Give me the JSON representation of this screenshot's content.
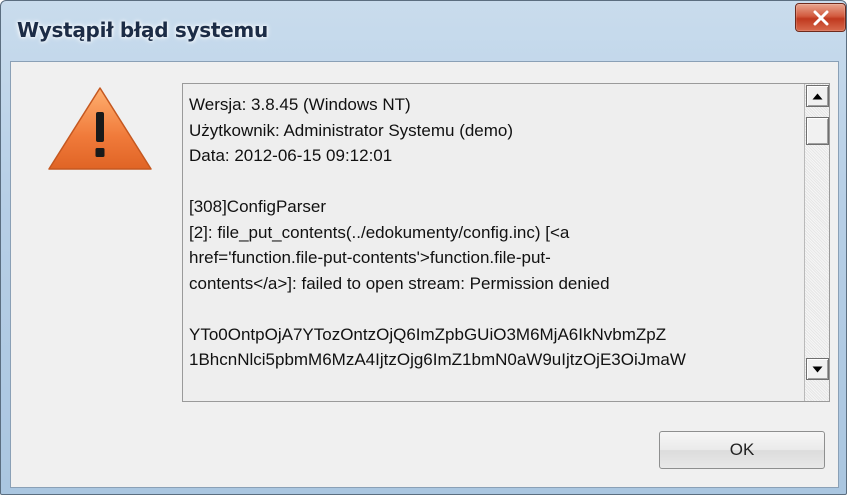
{
  "window": {
    "title": "Wystąpił błąd systemu",
    "close_glyph": "✕"
  },
  "icon": "warning-icon",
  "message": {
    "lines": [
      "Wersja: 3.8.45 (Windows NT)",
      "Użytkownik: Administrator Systemu (demo)",
      "Data: 2012-06-15 09:12:01",
      "",
      "[308]ConfigParser",
      "[2]: file_put_contents(../edokumenty/config.inc) [<a",
      "href='function.file-put-contents'>function.file-put-",
      "contents</a>]: failed to open stream: Permission denied",
      "",
      "YTo0OntpOjA7YTozOntzOjQ6ImZpbGUiO3M6MjA6IkNvbmZpZ",
      "1BhcnNlci5pbmM6MzA4IjtzOjg6ImZ1bmN0aW9uIjtzOjE3OiJmaW"
    ]
  },
  "buttons": {
    "ok_label": "OK"
  },
  "colors": {
    "title_text": "#1c2c46",
    "close_button": "#c0391f",
    "warning_fill": "#f07a3a"
  }
}
